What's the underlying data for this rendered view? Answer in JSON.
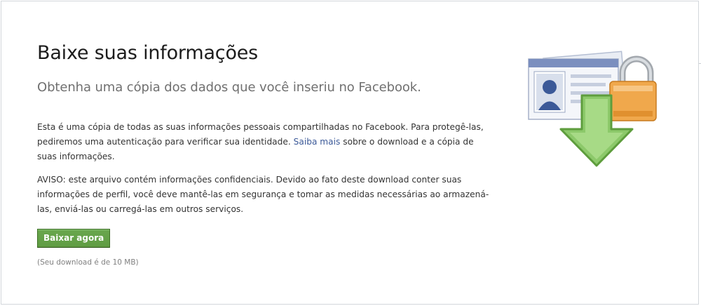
{
  "header": {
    "title": "Baixe suas informações",
    "subtitle": "Obtenha uma cópia dos dados que você inseriu no Facebook."
  },
  "body": {
    "paragraph1_before_link": "Esta é uma cópia de todas as suas informações pessoais compartilhadas no Facebook. Para protegê-las, pediremos uma autenticação para verificar sua identidade. ",
    "paragraph1_link": "Saiba mais",
    "paragraph1_after_link": " sobre o download e a cópia de suas informações.",
    "paragraph2": "AVISO: este arquivo contém informações confidenciais. Devido ao fato deste download conter suas informações de perfil, você deve mantê-las em segurança e tomar as medidas necessárias ao armazená-las, enviá-las ou carregá-las em outros serviços."
  },
  "actions": {
    "download_button_label": "Baixar agora",
    "download_note": "(Seu download é de 10 MB)"
  },
  "illustration": {
    "icons": [
      "id-card-icon",
      "padlock-icon",
      "download-arrow-icon"
    ],
    "colors": {
      "arrow": "#8cc96a",
      "lock": "#f0a84c",
      "card_header": "#7b8fbf",
      "button": "#5f9c42",
      "link": "#3b5998"
    }
  }
}
